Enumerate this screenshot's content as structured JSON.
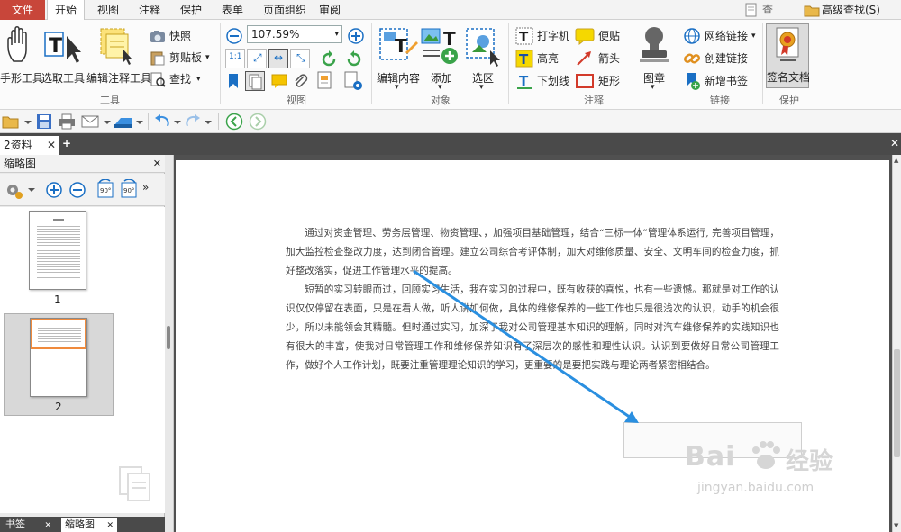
{
  "menubar": {
    "file": "文件",
    "tabs": [
      "开始",
      "视图",
      "注释",
      "保护",
      "表单",
      "页面组织",
      "审阅"
    ],
    "active_tab": "开始",
    "find": "查找(F)",
    "advanced_find": "高级查找(S)"
  },
  "ribbon": {
    "tools_group": {
      "label": "工具",
      "hand_tool": "手形工具",
      "select_tool": "选取工具",
      "edit_annotation_tool": "编辑注释工具",
      "snapshot": "快照",
      "clipboard": "剪贴板",
      "find": "查找"
    },
    "view_group": {
      "label": "视图",
      "zoom_value": "107.59%"
    },
    "object_group": {
      "label": "对象",
      "edit_content": "编辑内容",
      "add": "添加",
      "select_area": "选区"
    },
    "comment_group": {
      "label": "注释",
      "typewriter": "打字机",
      "sticky_note": "便贴",
      "highlight": "高亮",
      "arrow": "箭头",
      "underline": "下划线",
      "rectangle": "矩形",
      "stamp": "图章"
    },
    "link_group": {
      "label": "链接",
      "web_link": "网络链接",
      "create_link": "创建链接",
      "new_bookmark": "新增书签"
    },
    "protect_group": {
      "label": "保护",
      "sign_document": "签名文档"
    }
  },
  "document_tab": {
    "name": "2资料"
  },
  "left_panel": {
    "title": "缩略图",
    "pages": [
      "1",
      "2"
    ],
    "selected_page": "2",
    "bottom_tabs": [
      "书签",
      "缩略图"
    ],
    "active_bottom_tab": "缩略图"
  },
  "document": {
    "paragraphs": [
      "通过对资金管理、劳务层管理、物资管理、，加强项目基础管理，结合“三标一体”管理体系运行, 完善项目管理，加大监控检查整改力度，达到闭合管理。建立公司综合考评体制，加大对维修质量、安全、文明车间的检查力度，抓好整改落实，促进工作管理水平的提高。",
      "短暂的实习转眼而过，回顾实习生活，我在实习的过程中，既有收获的喜悦，也有一些遗憾。那就是对工作的认识仅仅停留在表面，只是在看人做，听人讲如何做，具体的维修保养的一些工作也只是很浅次的认识，动手的机会很少，所以未能领会其精髓。但时通过实习，加深了我对公司管理基本知识的理解，同时对汽车维修保养的实践知识也有很大的丰富，使我对日常管理工作和维修保养知识有了深层次的感性和理性认识。认识到要做好日常公司管理工作，做好个人工作计划，既要注重管理理论知识的学习，更重要的是要把实践与理论两者紧密相结合。"
    ]
  },
  "watermark": {
    "brand": "Bai",
    "brand_cn": "经验",
    "url": "jingyan.baidu.com"
  },
  "colors": {
    "file_tab": "#c8463a",
    "arrow": "#2a8fe0",
    "selection_orange": "#f08a3c"
  },
  "icons": [
    "hand-icon",
    "select-cursor-icon",
    "edit-annotation-icon",
    "camera-icon",
    "clipboard-icon",
    "find-icon",
    "zoom-out-icon",
    "zoom-in-icon",
    "rotate-left-icon",
    "rotate-right-icon",
    "open-folder-icon",
    "save-icon",
    "print-icon",
    "email-icon",
    "undo-icon",
    "redo-icon",
    "back-icon",
    "forward-icon",
    "gear-icon",
    "stamp-icon",
    "sign-document-icon",
    "web-link-icon",
    "create-link-icon",
    "bookmark-icon"
  ]
}
